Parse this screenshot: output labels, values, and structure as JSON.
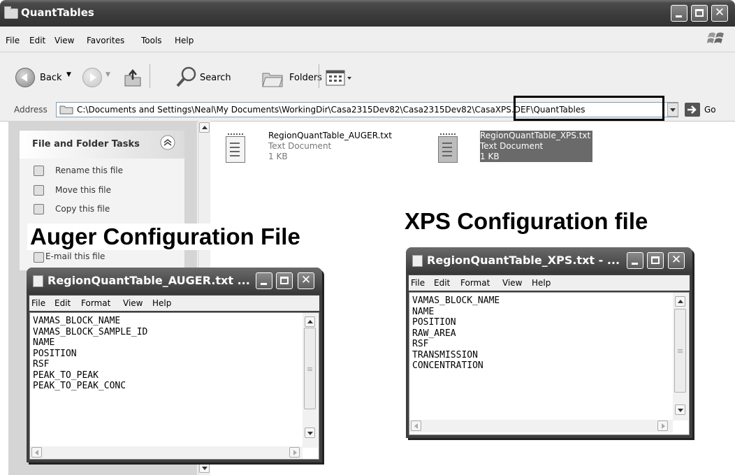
{
  "explorer": {
    "title": "QuantTables",
    "menu": [
      "File",
      "Edit",
      "View",
      "Favorites",
      "Tools",
      "Help"
    ],
    "toolbar": {
      "back": "Back",
      "search": "Search",
      "folders": "Folders"
    },
    "address": {
      "label": "Address",
      "path": "C:\\Documents and Settings\\Neal\\My Documents\\WorkingDir\\Casa2315Dev82\\Casa2315Dev82\\CasaXPS.DEF\\QuantTables",
      "go": "Go"
    },
    "tasks": {
      "header": "File and Folder Tasks",
      "items": [
        "Rename this file",
        "Move this file",
        "Copy this file",
        "E-mail this file"
      ]
    },
    "files": [
      {
        "name": "RegionQuantTable_AUGER.txt",
        "type": "Text Document",
        "size": "1 KB"
      },
      {
        "name": "RegionQuantTable_XPS.txt",
        "type": "Text Document",
        "size": "1 KB"
      }
    ]
  },
  "labels": {
    "auger": "Auger Configuration File",
    "xps": "XPS Configuration file"
  },
  "notepad_auger": {
    "title": "RegionQuantTable_AUGER.txt ...",
    "menu": [
      "File",
      "Edit",
      "Format",
      "View",
      "Help"
    ],
    "content": "VAMAS_BLOCK_NAME\nVAMAS_BLOCK_SAMPLE_ID\nNAME\nPOSITION\nRSF\nPEAK_TO_PEAK\nPEAK_TO_PEAK_CONC"
  },
  "notepad_xps": {
    "title": "RegionQuantTable_XPS.txt - ...",
    "menu": [
      "File",
      "Edit",
      "Format",
      "View",
      "Help"
    ],
    "content": "VAMAS_BLOCK_NAME\nNAME\nPOSITION\nRAW_AREA\nRSF\nTRANSMISSION\nCONCENTRATION"
  }
}
